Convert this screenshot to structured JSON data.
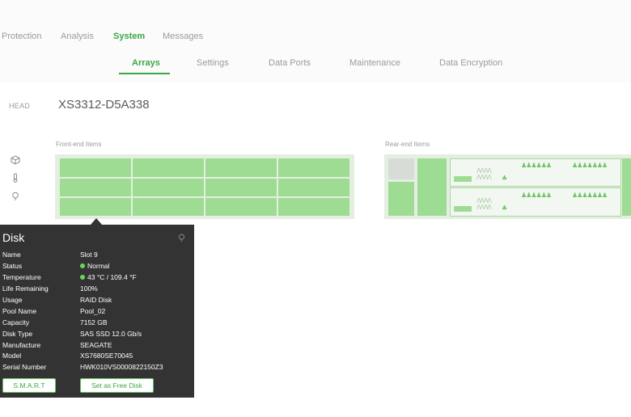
{
  "nav": {
    "primary": [
      {
        "label": "Protection",
        "active": false
      },
      {
        "label": "Analysis",
        "active": false
      },
      {
        "label": "System",
        "active": true
      },
      {
        "label": "Messages",
        "active": false
      }
    ],
    "secondary": [
      {
        "label": "Arrays",
        "active": true
      },
      {
        "label": "Settings",
        "active": false
      },
      {
        "label": "Data Ports",
        "active": false
      },
      {
        "label": "Maintenance",
        "active": false
      },
      {
        "label": "Data Encryption",
        "active": false
      }
    ]
  },
  "enclosure": {
    "head_label": "HEAD",
    "name": "XS3312-D5A338",
    "side_icons": [
      "cube-icon",
      "thermometer-icon",
      "lightbulb-icon"
    ],
    "front_label": "Front-end Items",
    "rear_label": "Rear-end Items",
    "front_grid": {
      "rows": 3,
      "cols": 4
    }
  },
  "disk_tooltip": {
    "title": "Disk",
    "icon": "lightbulb-icon",
    "fields": [
      {
        "label": "Name",
        "value": "Slot 9"
      },
      {
        "label": "Status",
        "value": "Normal",
        "status_dot": true
      },
      {
        "label": "Temperature",
        "value": "43 °C / 109.4 °F",
        "status_dot": true
      },
      {
        "label": "Life Remaining",
        "value": "100%"
      },
      {
        "label": "Usage",
        "value": "RAID Disk"
      },
      {
        "label": "Pool Name",
        "value": "Pool_02"
      },
      {
        "label": "Capacity",
        "value": "7152 GB"
      },
      {
        "label": "Disk Type",
        "value": "SAS SSD 12.0 Gb/s"
      },
      {
        "label": "Manufacture",
        "value": "SEAGATE"
      },
      {
        "label": "Model",
        "value": "XS7680SE70045"
      },
      {
        "label": "Serial Number",
        "value": "HWK010VS0000822150Z3"
      }
    ],
    "buttons": {
      "smart": "S.M.A.R.T",
      "set_free": "Set as Free Disk"
    }
  },
  "colors": {
    "accent": "#3aa843",
    "slot": "#9fdc93",
    "panel": "#e4efe1",
    "tooltip_bg": "#333333",
    "status_ok": "#6bd35d"
  }
}
